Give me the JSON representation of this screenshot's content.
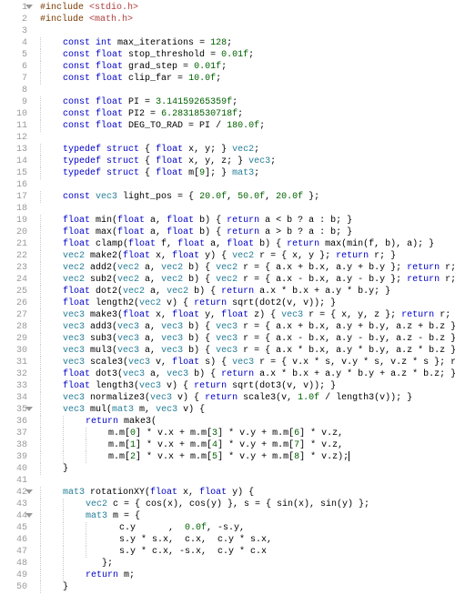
{
  "file": {
    "language": "c"
  },
  "fold_lines": [
    1,
    35,
    42,
    44
  ],
  "lines": [
    {
      "n": 1,
      "seg": [
        [
          "pp",
          "#include "
        ],
        [
          "str",
          "<stdio.h>"
        ]
      ]
    },
    {
      "n": 2,
      "seg": [
        [
          "pp",
          "#include "
        ],
        [
          "str",
          "<math.h>"
        ]
      ]
    },
    {
      "n": 3,
      "seg": []
    },
    {
      "n": 4,
      "i": 1,
      "seg": [
        [
          "kw",
          "const"
        ],
        [
          "",
          " "
        ],
        [
          "kw",
          "int"
        ],
        [
          "",
          " max_iterations = "
        ],
        [
          "num",
          "128"
        ],
        [
          "",
          ";"
        ]
      ]
    },
    {
      "n": 5,
      "i": 1,
      "seg": [
        [
          "kw",
          "const"
        ],
        [
          "",
          " "
        ],
        [
          "kw",
          "float"
        ],
        [
          "",
          " stop_threshold = "
        ],
        [
          "num",
          "0.01f"
        ],
        [
          "",
          ";"
        ]
      ]
    },
    {
      "n": 6,
      "i": 1,
      "seg": [
        [
          "kw",
          "const"
        ],
        [
          "",
          " "
        ],
        [
          "kw",
          "float"
        ],
        [
          "",
          " grad_step = "
        ],
        [
          "num",
          "0.01f"
        ],
        [
          "",
          ";"
        ]
      ]
    },
    {
      "n": 7,
      "i": 1,
      "seg": [
        [
          "kw",
          "const"
        ],
        [
          "",
          " "
        ],
        [
          "kw",
          "float"
        ],
        [
          "",
          " clip_far = "
        ],
        [
          "num",
          "10.0f"
        ],
        [
          "",
          ";"
        ]
      ]
    },
    {
      "n": 8,
      "seg": []
    },
    {
      "n": 9,
      "i": 1,
      "seg": [
        [
          "kw",
          "const"
        ],
        [
          "",
          " "
        ],
        [
          "kw",
          "float"
        ],
        [
          "",
          " PI = "
        ],
        [
          "num",
          "3.14159265359f"
        ],
        [
          "",
          ";"
        ]
      ]
    },
    {
      "n": 10,
      "i": 1,
      "seg": [
        [
          "kw",
          "const"
        ],
        [
          "",
          " "
        ],
        [
          "kw",
          "float"
        ],
        [
          "",
          " PI2 = "
        ],
        [
          "num",
          "6.28318530718f"
        ],
        [
          "",
          ";"
        ]
      ]
    },
    {
      "n": 11,
      "i": 1,
      "seg": [
        [
          "kw",
          "const"
        ],
        [
          "",
          " "
        ],
        [
          "kw",
          "float"
        ],
        [
          "",
          " DEG_TO_RAD = PI / "
        ],
        [
          "num",
          "180.0f"
        ],
        [
          "",
          ";"
        ]
      ]
    },
    {
      "n": 12,
      "seg": []
    },
    {
      "n": 13,
      "i": 1,
      "seg": [
        [
          "kw",
          "typedef"
        ],
        [
          "",
          " "
        ],
        [
          "kw",
          "struct"
        ],
        [
          "",
          " { "
        ],
        [
          "kw",
          "float"
        ],
        [
          "",
          " x, y; } "
        ],
        [
          "ty",
          "vec2"
        ],
        [
          "",
          ";"
        ]
      ]
    },
    {
      "n": 14,
      "i": 1,
      "seg": [
        [
          "kw",
          "typedef"
        ],
        [
          "",
          " "
        ],
        [
          "kw",
          "struct"
        ],
        [
          "",
          " { "
        ],
        [
          "kw",
          "float"
        ],
        [
          "",
          " x, y, z; } "
        ],
        [
          "ty",
          "vec3"
        ],
        [
          "",
          ";"
        ]
      ]
    },
    {
      "n": 15,
      "i": 1,
      "seg": [
        [
          "kw",
          "typedef"
        ],
        [
          "",
          " "
        ],
        [
          "kw",
          "struct"
        ],
        [
          "",
          " { "
        ],
        [
          "kw",
          "float"
        ],
        [
          "",
          " m["
        ],
        [
          "num",
          "9"
        ],
        [
          "",
          "]; } "
        ],
        [
          "ty",
          "mat3"
        ],
        [
          "",
          ";"
        ]
      ]
    },
    {
      "n": 16,
      "seg": []
    },
    {
      "n": 17,
      "i": 1,
      "seg": [
        [
          "kw",
          "const"
        ],
        [
          "",
          " "
        ],
        [
          "ty",
          "vec3"
        ],
        [
          "",
          " light_pos = { "
        ],
        [
          "num",
          "20.0f"
        ],
        [
          "",
          ", "
        ],
        [
          "num",
          "50.0f"
        ],
        [
          "",
          ", "
        ],
        [
          "num",
          "20.0f"
        ],
        [
          "",
          " };"
        ]
      ]
    },
    {
      "n": 18,
      "seg": []
    },
    {
      "n": 19,
      "i": 1,
      "seg": [
        [
          "kw",
          "float"
        ],
        [
          "",
          " min("
        ],
        [
          "kw",
          "float"
        ],
        [
          "",
          " a, "
        ],
        [
          "kw",
          "float"
        ],
        [
          "",
          " b) { "
        ],
        [
          "kw",
          "return"
        ],
        [
          "",
          " a < b ? a : b; }"
        ]
      ]
    },
    {
      "n": 20,
      "i": 1,
      "seg": [
        [
          "kw",
          "float"
        ],
        [
          "",
          " max("
        ],
        [
          "kw",
          "float"
        ],
        [
          "",
          " a, "
        ],
        [
          "kw",
          "float"
        ],
        [
          "",
          " b) { "
        ],
        [
          "kw",
          "return"
        ],
        [
          "",
          " a > b ? a : b; }"
        ]
      ]
    },
    {
      "n": 21,
      "i": 1,
      "seg": [
        [
          "kw",
          "float"
        ],
        [
          "",
          " clamp("
        ],
        [
          "kw",
          "float"
        ],
        [
          "",
          " f, "
        ],
        [
          "kw",
          "float"
        ],
        [
          "",
          " a, "
        ],
        [
          "kw",
          "float"
        ],
        [
          "",
          " b) { "
        ],
        [
          "kw",
          "return"
        ],
        [
          "",
          " max(min(f, b), a); }"
        ]
      ]
    },
    {
      "n": 22,
      "i": 1,
      "seg": [
        [
          "ty",
          "vec2"
        ],
        [
          "",
          " make2("
        ],
        [
          "kw",
          "float"
        ],
        [
          "",
          " x, "
        ],
        [
          "kw",
          "float"
        ],
        [
          "",
          " y) { "
        ],
        [
          "ty",
          "vec2"
        ],
        [
          "",
          " r = { x, y }; "
        ],
        [
          "kw",
          "return"
        ],
        [
          "",
          " r; }"
        ]
      ]
    },
    {
      "n": 23,
      "i": 1,
      "seg": [
        [
          "ty",
          "vec2"
        ],
        [
          "",
          " add2("
        ],
        [
          "ty",
          "vec2"
        ],
        [
          "",
          " a, "
        ],
        [
          "ty",
          "vec2"
        ],
        [
          "",
          " b) { "
        ],
        [
          "ty",
          "vec2"
        ],
        [
          "",
          " r = { a.x + b.x, a.y + b.y }; "
        ],
        [
          "kw",
          "return"
        ],
        [
          "",
          " r; }"
        ]
      ]
    },
    {
      "n": 24,
      "i": 1,
      "seg": [
        [
          "ty",
          "vec2"
        ],
        [
          "",
          " sub2("
        ],
        [
          "ty",
          "vec2"
        ],
        [
          "",
          " a, "
        ],
        [
          "ty",
          "vec2"
        ],
        [
          "",
          " b) { "
        ],
        [
          "ty",
          "vec2"
        ],
        [
          "",
          " r = { a.x - b.x, a.y - b.y }; "
        ],
        [
          "kw",
          "return"
        ],
        [
          "",
          " r; }"
        ]
      ]
    },
    {
      "n": 25,
      "i": 1,
      "seg": [
        [
          "kw",
          "float"
        ],
        [
          "",
          " dot2("
        ],
        [
          "ty",
          "vec2"
        ],
        [
          "",
          " a, "
        ],
        [
          "ty",
          "vec2"
        ],
        [
          "",
          " b) { "
        ],
        [
          "kw",
          "return"
        ],
        [
          "",
          " a.x * b.x + a.y * b.y; }"
        ]
      ]
    },
    {
      "n": 26,
      "i": 1,
      "seg": [
        [
          "kw",
          "float"
        ],
        [
          "",
          " length2("
        ],
        [
          "ty",
          "vec2"
        ],
        [
          "",
          " v) { "
        ],
        [
          "kw",
          "return"
        ],
        [
          "",
          " sqrt(dot2(v, v)); }"
        ]
      ]
    },
    {
      "n": 27,
      "i": 1,
      "seg": [
        [
          "ty",
          "vec3"
        ],
        [
          "",
          " make3("
        ],
        [
          "kw",
          "float"
        ],
        [
          "",
          " x, "
        ],
        [
          "kw",
          "float"
        ],
        [
          "",
          " y, "
        ],
        [
          "kw",
          "float"
        ],
        [
          "",
          " z) { "
        ],
        [
          "ty",
          "vec3"
        ],
        [
          "",
          " r = { x, y, z }; "
        ],
        [
          "kw",
          "return"
        ],
        [
          "",
          " r; }"
        ]
      ]
    },
    {
      "n": 28,
      "i": 1,
      "seg": [
        [
          "ty",
          "vec3"
        ],
        [
          "",
          " add3("
        ],
        [
          "ty",
          "vec3"
        ],
        [
          "",
          " a, "
        ],
        [
          "ty",
          "vec3"
        ],
        [
          "",
          " b) { "
        ],
        [
          "ty",
          "vec3"
        ],
        [
          "",
          " r = { a.x + b.x, a.y + b.y, a.z + b.z }; re"
        ]
      ]
    },
    {
      "n": 29,
      "i": 1,
      "seg": [
        [
          "ty",
          "vec3"
        ],
        [
          "",
          " sub3("
        ],
        [
          "ty",
          "vec3"
        ],
        [
          "",
          " a, "
        ],
        [
          "ty",
          "vec3"
        ],
        [
          "",
          " b) { "
        ],
        [
          "ty",
          "vec3"
        ],
        [
          "",
          " r = { a.x - b.x, a.y - b.y, a.z - b.z }; re"
        ]
      ]
    },
    {
      "n": 30,
      "i": 1,
      "seg": [
        [
          "ty",
          "vec3"
        ],
        [
          "",
          " mul3("
        ],
        [
          "ty",
          "vec3"
        ],
        [
          "",
          " a, "
        ],
        [
          "ty",
          "vec3"
        ],
        [
          "",
          " b) { "
        ],
        [
          "ty",
          "vec3"
        ],
        [
          "",
          " r = { a.x * b.x, a.y * b.y, a.z * b.z }; re"
        ]
      ]
    },
    {
      "n": 31,
      "i": 1,
      "seg": [
        [
          "ty",
          "vec3"
        ],
        [
          "",
          " scale3("
        ],
        [
          "ty",
          "vec3"
        ],
        [
          "",
          " v, "
        ],
        [
          "kw",
          "float"
        ],
        [
          "",
          " s) { "
        ],
        [
          "ty",
          "vec3"
        ],
        [
          "",
          " r = { v.x * s, v.y * s, v.z * s }; retu"
        ]
      ]
    },
    {
      "n": 32,
      "i": 1,
      "seg": [
        [
          "kw",
          "float"
        ],
        [
          "",
          " dot3("
        ],
        [
          "ty",
          "vec3"
        ],
        [
          "",
          " a, "
        ],
        [
          "ty",
          "vec3"
        ],
        [
          "",
          " b) { "
        ],
        [
          "kw",
          "return"
        ],
        [
          "",
          " a.x * b.x + a.y * b.y + a.z * b.z; }"
        ]
      ]
    },
    {
      "n": 33,
      "i": 1,
      "seg": [
        [
          "kw",
          "float"
        ],
        [
          "",
          " length3("
        ],
        [
          "ty",
          "vec3"
        ],
        [
          "",
          " v) { "
        ],
        [
          "kw",
          "return"
        ],
        [
          "",
          " sqrt(dot3(v, v)); }"
        ]
      ]
    },
    {
      "n": 34,
      "i": 1,
      "seg": [
        [
          "ty",
          "vec3"
        ],
        [
          "",
          " normalize3("
        ],
        [
          "ty",
          "vec3"
        ],
        [
          "",
          " v) { "
        ],
        [
          "kw",
          "return"
        ],
        [
          "",
          " scale3(v, "
        ],
        [
          "num",
          "1.0f"
        ],
        [
          "",
          " / length3(v)); }"
        ]
      ]
    },
    {
      "n": 35,
      "i": 1,
      "seg": [
        [
          "ty",
          "vec3"
        ],
        [
          "",
          " mul("
        ],
        [
          "ty",
          "mat3"
        ],
        [
          "",
          " m, "
        ],
        [
          "ty",
          "vec3"
        ],
        [
          "",
          " v) {"
        ]
      ]
    },
    {
      "n": 36,
      "i": 2,
      "seg": [
        [
          "kw",
          "return"
        ],
        [
          "",
          " make3("
        ]
      ]
    },
    {
      "n": 37,
      "i": 3,
      "seg": [
        [
          "",
          "m.m["
        ],
        [
          "num",
          "0"
        ],
        [
          "",
          "] * v.x + m.m["
        ],
        [
          "num",
          "3"
        ],
        [
          "",
          "] * v.y + m.m["
        ],
        [
          "num",
          "6"
        ],
        [
          "",
          "] * v.z,"
        ]
      ]
    },
    {
      "n": 38,
      "i": 3,
      "seg": [
        [
          "",
          "m.m["
        ],
        [
          "num",
          "1"
        ],
        [
          "",
          "] * v.x + m.m["
        ],
        [
          "num",
          "4"
        ],
        [
          "",
          "] * v.y + m.m["
        ],
        [
          "num",
          "7"
        ],
        [
          "",
          "] * v.z,"
        ]
      ]
    },
    {
      "n": 39,
      "i": 3,
      "seg": [
        [
          "",
          "m.m["
        ],
        [
          "num",
          "2"
        ],
        [
          "",
          "] * v.x + m.m["
        ],
        [
          "num",
          "5"
        ],
        [
          "",
          "] * v.y + m.m["
        ],
        [
          "num",
          "8"
        ],
        [
          "",
          "] * v.z);"
        ]
      ],
      "cursor": true
    },
    {
      "n": 40,
      "i": 1,
      "seg": [
        [
          "",
          "}"
        ]
      ]
    },
    {
      "n": 41,
      "seg": []
    },
    {
      "n": 42,
      "i": 1,
      "seg": [
        [
          "ty",
          "mat3"
        ],
        [
          "",
          " rotationXY("
        ],
        [
          "kw",
          "float"
        ],
        [
          "",
          " x, "
        ],
        [
          "kw",
          "float"
        ],
        [
          "",
          " y) {"
        ]
      ]
    },
    {
      "n": 43,
      "i": 2,
      "seg": [
        [
          "ty",
          "vec2"
        ],
        [
          "",
          " c = { cos(x), cos(y) }, s = { sin(x), sin(y) };"
        ]
      ]
    },
    {
      "n": 44,
      "i": 2,
      "seg": [
        [
          "ty",
          "mat3"
        ],
        [
          "",
          " m = {"
        ]
      ]
    },
    {
      "n": 45,
      "i": 3,
      "seg": [
        [
          "",
          "  c.y      ,  "
        ],
        [
          "num",
          "0.0f"
        ],
        [
          "",
          ", -s.y,"
        ]
      ]
    },
    {
      "n": 46,
      "i": 3,
      "seg": [
        [
          "",
          "  s.y * s.x,  c.x,  c.y * s.x,"
        ]
      ]
    },
    {
      "n": 47,
      "i": 3,
      "seg": [
        [
          "",
          "  s.y * c.x, -s.x,  c.y * c.x"
        ]
      ]
    },
    {
      "n": 48,
      "i": 2,
      "seg": [
        [
          "",
          "   };"
        ]
      ]
    },
    {
      "n": 49,
      "i": 2,
      "seg": [
        [
          "kw",
          "return"
        ],
        [
          "",
          " m;"
        ]
      ]
    },
    {
      "n": 50,
      "i": 1,
      "seg": [
        [
          "",
          "}"
        ]
      ]
    }
  ]
}
